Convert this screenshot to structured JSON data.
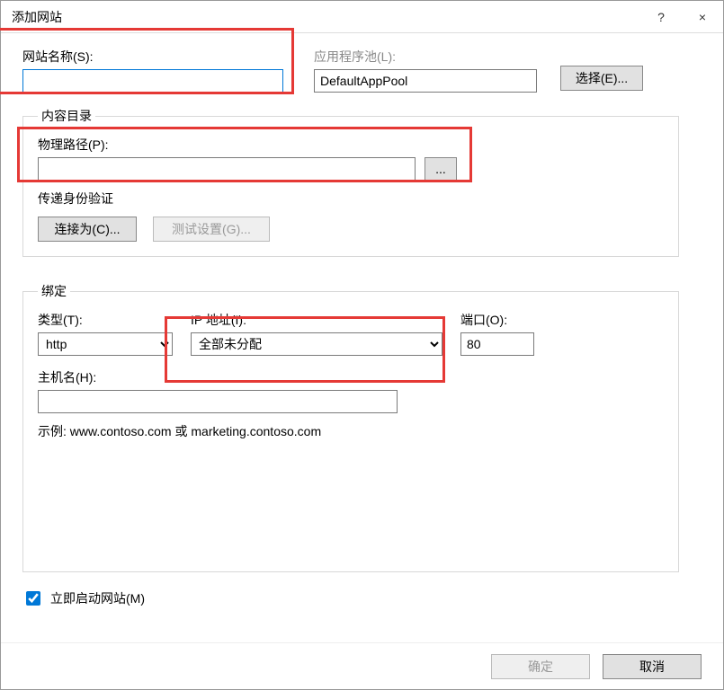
{
  "title": "添加网站",
  "help_char": "?",
  "close_char": "×",
  "site_name": {
    "label": "网站名称(S):",
    "value": ""
  },
  "app_pool": {
    "label": "应用程序池(L):",
    "value": "DefaultAppPool",
    "select_btn": "选择(E)..."
  },
  "content_dir": {
    "legend": "内容目录",
    "phys_path_label": "物理路径(P):",
    "phys_path_value": "",
    "browse_btn": "...",
    "passthrough_label": "传递身份验证",
    "connect_as_btn": "连接为(C)...",
    "test_settings_btn": "测试设置(G)..."
  },
  "binding": {
    "legend": "绑定",
    "type_label": "类型(T):",
    "type_value": "http",
    "ip_label": "IP 地址(I):",
    "ip_value": "全部未分配",
    "port_label": "端口(O):",
    "port_value": "80",
    "host_label": "主机名(H):",
    "host_value": "",
    "example": "示例: www.contoso.com 或 marketing.contoso.com"
  },
  "start_immediately": {
    "label": "立即启动网站(M)",
    "checked": true
  },
  "ok_btn": "确定",
  "cancel_btn": "取消"
}
